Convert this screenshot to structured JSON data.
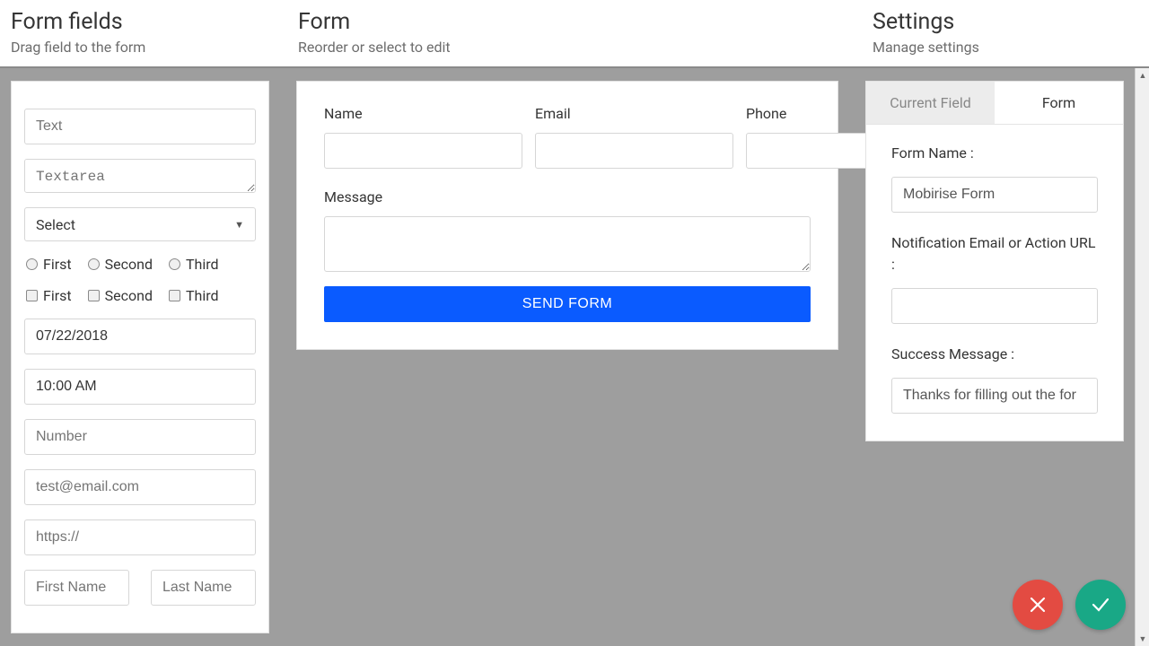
{
  "header": {
    "left_title": "Form fields",
    "left_sub": "Drag field to the form",
    "mid_title": "Form",
    "mid_sub": "Reorder or select to edit",
    "right_title": "Settings",
    "right_sub": "Manage settings"
  },
  "palette": {
    "text_placeholder": "Text",
    "textarea_placeholder": "Textarea",
    "select_label": "Select",
    "radio_options": [
      "First",
      "Second",
      "Third"
    ],
    "check_options": [
      "First",
      "Second",
      "Third"
    ],
    "date_value": "07/22/2018",
    "time_value": "10:00 AM",
    "number_placeholder": "Number",
    "email_placeholder": "test@email.com",
    "url_placeholder": "https://",
    "firstname_placeholder": "First Name",
    "lastname_placeholder": "Last Name"
  },
  "form": {
    "name_label": "Name",
    "email_label": "Email",
    "phone_label": "Phone",
    "message_label": "Message",
    "submit_label": "SEND FORM"
  },
  "settings": {
    "tab_current": "Current Field",
    "tab_form": "Form",
    "form_name_label": "Form Name :",
    "form_name_value": "Mobirise Form",
    "notify_label": "Notification Email or Action URL :",
    "notify_value": "",
    "success_label": "Success Message :",
    "success_value": "Thanks for filling out the for"
  }
}
